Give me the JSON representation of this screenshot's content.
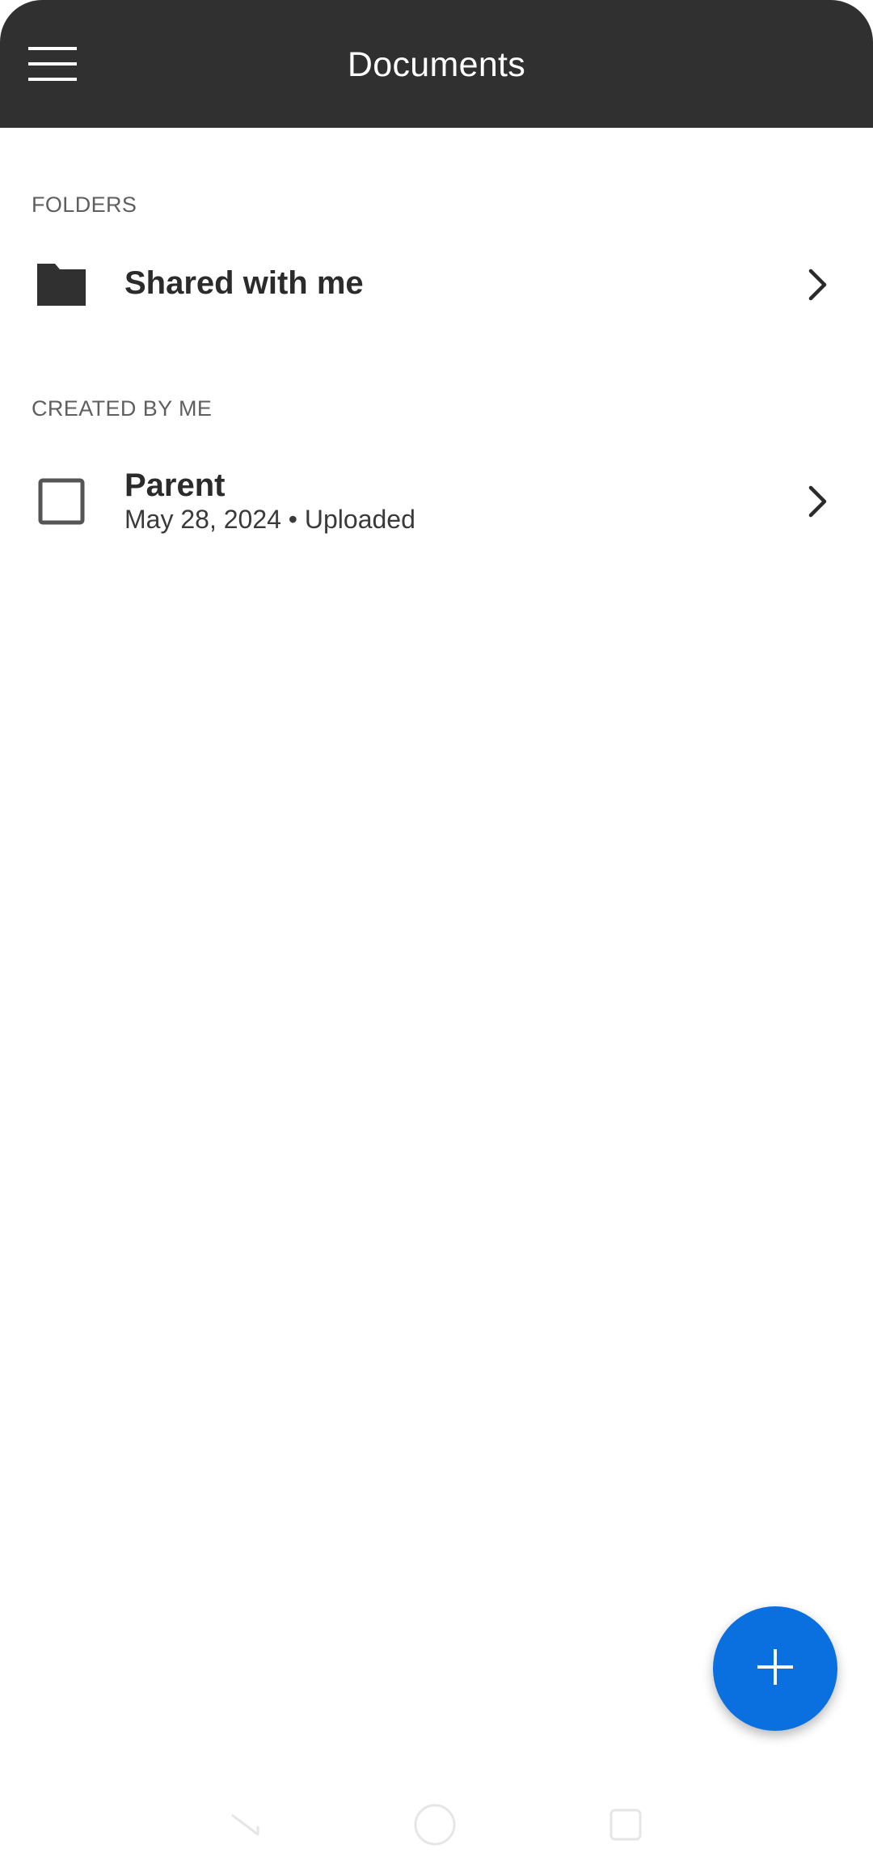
{
  "header": {
    "title": "Documents",
    "menu_icon": "hamburger-menu-icon"
  },
  "sections": {
    "folders_label": "FOLDERS",
    "created_label": "CREATED BY ME"
  },
  "folders": [
    {
      "title": "Shared with me",
      "icon": "folder-icon"
    }
  ],
  "documents": [
    {
      "title": "Parent",
      "date": "May 28, 2024",
      "status": "Uploaded",
      "meta": "May 28, 2024 • Uploaded",
      "icon": "document-icon"
    }
  ],
  "fab": {
    "icon": "plus-icon"
  },
  "nav": {
    "back_icon": "back-icon",
    "home_icon": "home-icon",
    "recents_icon": "recents-icon"
  },
  "colors": {
    "app_bar": "#303030",
    "fab": "#0a70e0",
    "text": "#2b2b2b",
    "section_header": "#5f5f5f",
    "nav_icons": "#e6e6e6"
  }
}
